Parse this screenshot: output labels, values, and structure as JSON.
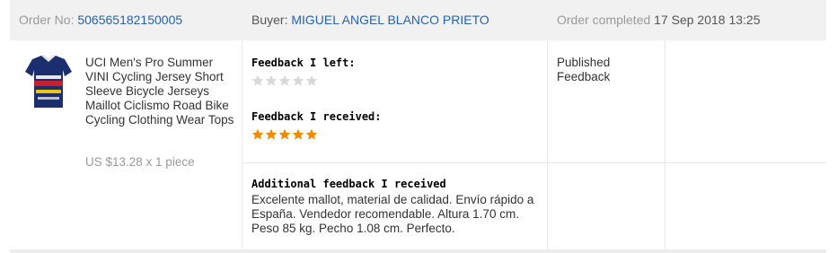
{
  "order": {
    "order_no_label": "Order No:",
    "order_no": "506565182150005",
    "buyer_label": "Buyer:",
    "buyer_name": "MIGUEL ANGEL BLANCO PRIETO",
    "completed_label": "Order completed",
    "completed_date": "17 Sep 2018 13:25"
  },
  "product": {
    "title": "UCI Men's Pro Summer VINI Cycling Jersey Short Sleeve Bicycle Jerseys Maillot Ciclismo Road Bike Cycling Clothing Wear Tops",
    "price": "US $13.28 x 1 piece",
    "image_icon": "cycling-jersey-thumbnail"
  },
  "feedback": {
    "left_heading": "Feedback I left:",
    "left_rating": 0,
    "received_heading": "Feedback I received:",
    "received_rating": 5,
    "max_rating": 5,
    "additional_heading": "Additional feedback I received",
    "additional_text": "Excelente mallot, material de calidad. Envío rápido a España. Vendedor recomendable. Altura 1.70 cm. Peso 85 kg. Pecho 1.08 cm. Perfecto."
  },
  "status": {
    "text": "Published Feedback"
  },
  "colors": {
    "link": "#2762b2",
    "star_filled": "#f08c00",
    "star_empty": "#d9d9d9",
    "header_bg": "#f1f1f1"
  }
}
